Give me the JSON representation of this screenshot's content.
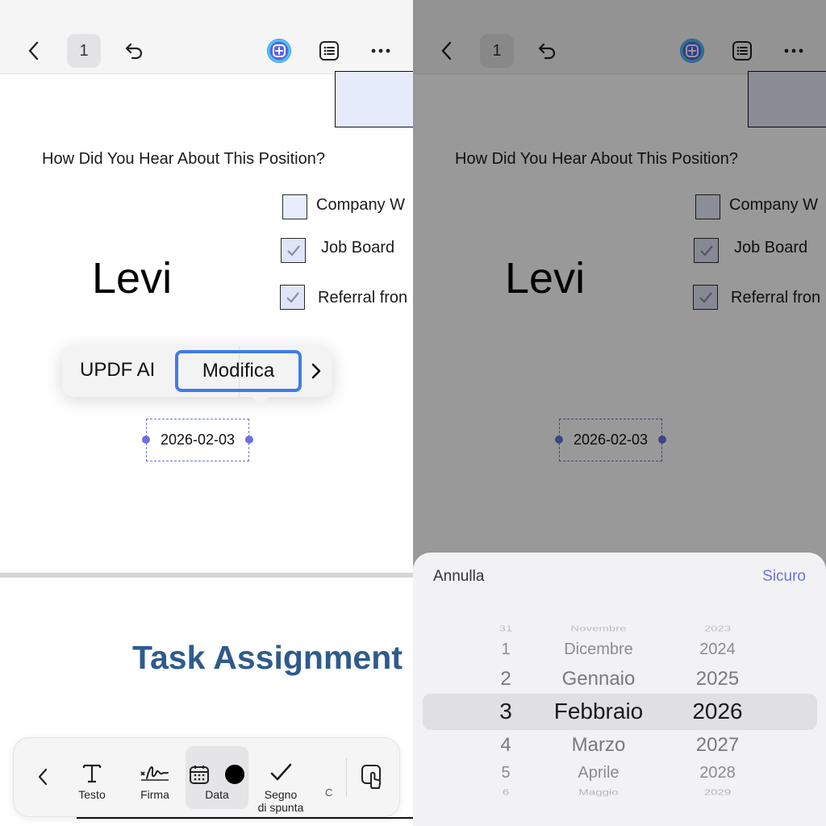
{
  "toolbar": {
    "page_number": "1"
  },
  "document": {
    "question": "How Did You Hear About This Position?",
    "checkboxes": [
      {
        "label": "Company W",
        "checked": false
      },
      {
        "label": "Job Board",
        "checked": true
      },
      {
        "label": "Referral fron",
        "checked": true
      }
    ],
    "signature": "Levi",
    "date_value": "2026-02-03",
    "section_title": "Task Assignment"
  },
  "context_menu": {
    "ai_label": "UPDF AI",
    "edit_label": "Modifica"
  },
  "bottom_toolbar": {
    "items": [
      {
        "label": "Testo"
      },
      {
        "label": "Firma"
      },
      {
        "label": "Data"
      },
      {
        "label_line1": "Segno",
        "label_line2": "di spunta"
      }
    ],
    "more": "C"
  },
  "picker": {
    "cancel_label": "Annulla",
    "confirm_label": "Sicuro",
    "days": [
      "31",
      "1",
      "2",
      "3",
      "4",
      "5",
      "6"
    ],
    "months": [
      "Novembre",
      "Dicembre",
      "Gennaio",
      "Febbraio",
      "Marzo",
      "Aprile",
      "Maggio"
    ],
    "years": [
      "2023",
      "2024",
      "2025",
      "2026",
      "2027",
      "2028",
      "2029"
    ],
    "selected_index": 3
  },
  "colors": {
    "accent": "#3f7ce9",
    "picker_accent": "#6a73e0",
    "title_blue": "#2f5b8d"
  }
}
